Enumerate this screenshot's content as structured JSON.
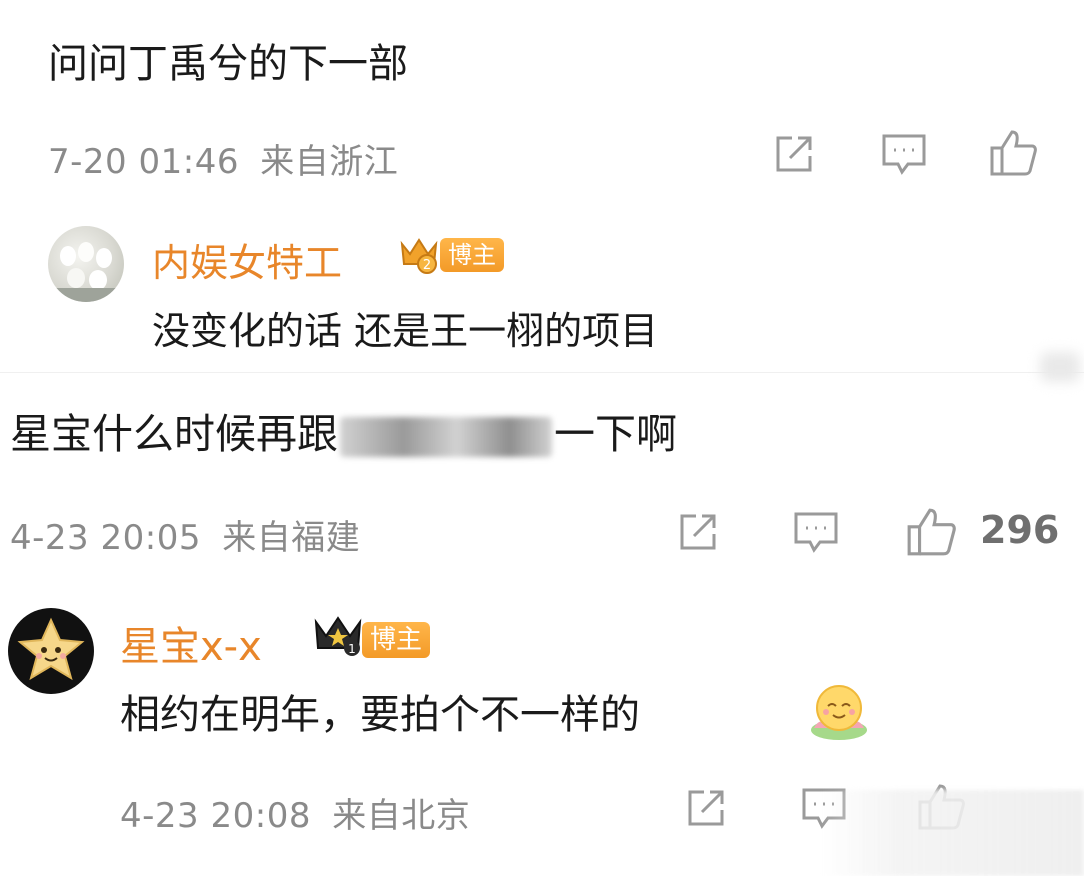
{
  "comment1": {
    "text": "问问丁禹兮的下一部",
    "date": "7-20 01:46",
    "location": "来自浙江"
  },
  "reply1": {
    "author": "内娱女特工",
    "level": "2",
    "badge": "博主",
    "text": "没变化的话 还是王一栩的项目"
  },
  "comment2": {
    "text": "星宝什么时候再跟",
    "text_tail": "一下啊",
    "date": "4-23 20:05",
    "location": "来自福建",
    "likes": "296"
  },
  "reply2": {
    "author": "星宝x-x",
    "level": "1",
    "badge": "博主",
    "text": "相约在明年，要拍个不一样的",
    "date": "4-23 20:08",
    "location": "来自北京"
  },
  "icons": [
    "share-icon",
    "comment-icon",
    "like-icon",
    "crown-icon",
    "emoji-smile-icon"
  ],
  "colors": {
    "name": "#e8862a",
    "meta": "#8a8a8a",
    "badge": "#f5a030",
    "icon": "#9a9a9a"
  }
}
